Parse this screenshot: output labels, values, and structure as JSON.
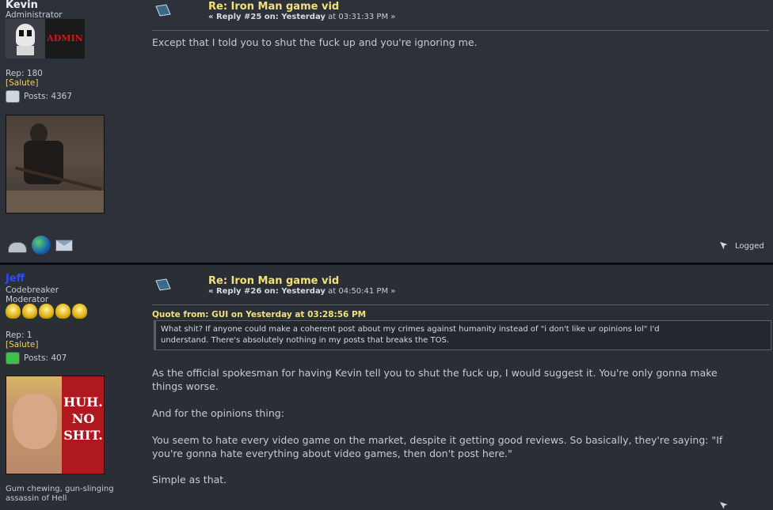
{
  "posts": [
    {
      "author": {
        "name": "Kevin",
        "rank": "Administrator",
        "rep": "Rep: 180",
        "salute": "[Salute]",
        "posts": "Posts: 4367",
        "badge_text": "ADMIN"
      },
      "title": "Re: Iron Man game vid",
      "meta_prefix": "« Reply #25 on: Yesterday",
      "meta_time": " at 03:31:33 PM »",
      "body": "Except that I told you to shut the fuck up  and you're ignoring me.",
      "logged": "Logged"
    },
    {
      "author": {
        "name": "Jeff",
        "rank1": "Codebreaker",
        "rank2": "Moderator",
        "rep": "Rep: 1",
        "salute": "[Salute]",
        "posts": "Posts: 407",
        "avatar_text1": "HUH.",
        "avatar_text2": "NO",
        "avatar_text3": "SHIT.",
        "signature_line1": "Gum chewing, gun-slinging",
        "signature_line2": "assassin of Hell"
      },
      "title": "Re: Iron Man game vid",
      "meta_prefix": "« Reply #26 on: Yesterday",
      "meta_time": " at 04:50:41 PM »",
      "quote_header": "Quote from: GUI on Yesterday at 03:28:56 PM",
      "quote_line1": "What shit? If anyone could make a coherent post about my crimes against humanity instead of \"i don't like ur opinions lol\"  I'd",
      "quote_line2": "understand. There's absolutely nothing in my posts that breaks the TOS.",
      "para1_line1": "As the official spokesman for having Kevin tell you to shut the fuck up, I would suggest it. You're only gonna make",
      "para1_line2": "things worse.",
      "para2": "And for the opinions thing:",
      "para3_line1": "You seem to hate every video game on the market, despite it getting good reviews. So basically, they're saying: \"If",
      "para3_line2": "you're gonna hate everything about video games, then don't post here.\"",
      "para4": "Simple as that."
    }
  ],
  "colors": {
    "title": "#f2e07a",
    "moderator_name": "#2a4bff",
    "background": "#2d323a"
  }
}
